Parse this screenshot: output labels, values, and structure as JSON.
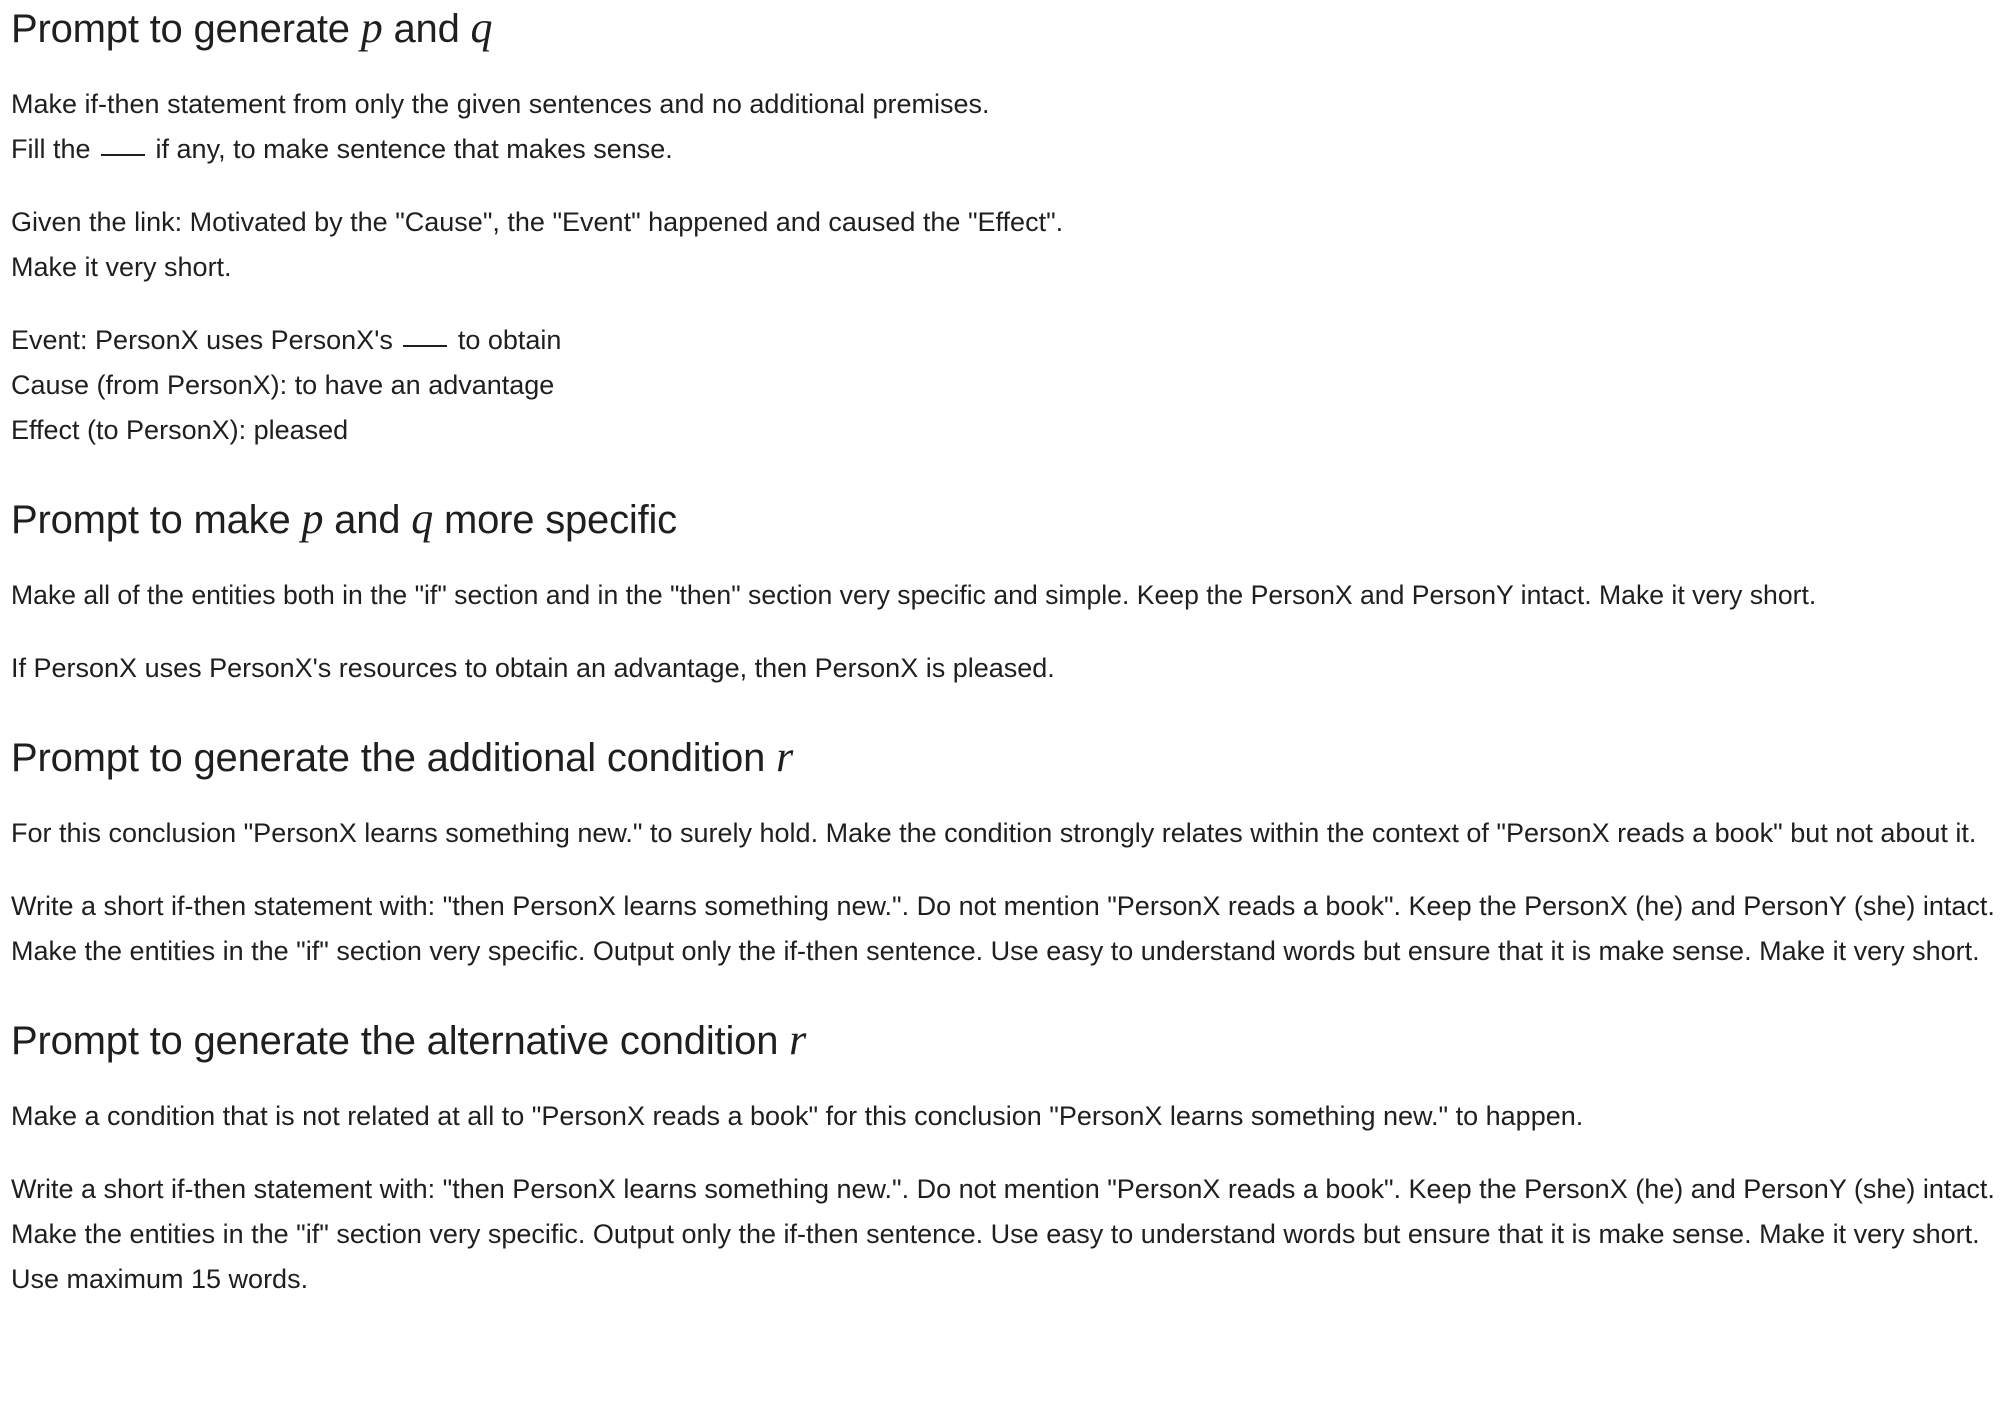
{
  "section1": {
    "title_prefix": "Prompt to generate ",
    "var_p": "p",
    "title_mid": " and ",
    "var_q": "q",
    "para1": {
      "line1": "Make if-then statement from only the given sentences and no additional premises.",
      "line2_a": "Fill the ",
      "line2_b": " if any, to make sentence that makes sense."
    },
    "para2": {
      "line1": "Given the link: Motivated by the \"Cause\", the \"Event\" happened and caused the \"Effect\".",
      "line2": "Make it very short."
    },
    "para3": {
      "line1_a": "Event: PersonX uses PersonX's ",
      "line1_b": " to obtain",
      "line2": "Cause (from PersonX): to have an advantage",
      "line3": "Effect (to PersonX): pleased"
    }
  },
  "section2": {
    "title_prefix": "Prompt to make ",
    "var_p": "p",
    "title_mid": " and ",
    "var_q": "q",
    "title_suffix": " more specific",
    "para1": "Make all of the entities both in the \"if\" section and in the \"then\" section very specific and simple. Keep the PersonX and PersonY intact. Make it very short.",
    "para2": "If PersonX uses PersonX's resources to obtain an advantage, then PersonX is pleased."
  },
  "section3": {
    "title_prefix": "Prompt to generate the additional condition ",
    "var_r": "r",
    "para1": "For this conclusion \"PersonX learns something new.\" to surely hold. Make the condition strongly relates within the context of \"PersonX reads a book\" but not about it.",
    "para2": "Write a short if-then statement with: \"then PersonX learns something new.\". Do not mention \"PersonX reads a book\". Keep the PersonX (he) and PersonY (she) intact. Make the entities in the \"if\" section very specific. Output only the if-then sentence. Use easy to understand words but ensure that it is make sense. Make it very short."
  },
  "section4": {
    "title_prefix": "Prompt to generate the alternative condition ",
    "var_r": "r",
    "para1": "Make a condition that is not related at all to \"PersonX reads a book\" for this conclusion \"PersonX learns something new.\" to happen.",
    "para2": "Write a short if-then statement with: \"then PersonX learns something new.\". Do not mention \"PersonX reads a book\". Keep the PersonX (he) and PersonY (she) intact. Make the entities in the \"if\" section very specific. Output only the if-then sentence. Use easy to understand words but ensure that it is make sense. Make it very short. Use maximum 15 words."
  }
}
